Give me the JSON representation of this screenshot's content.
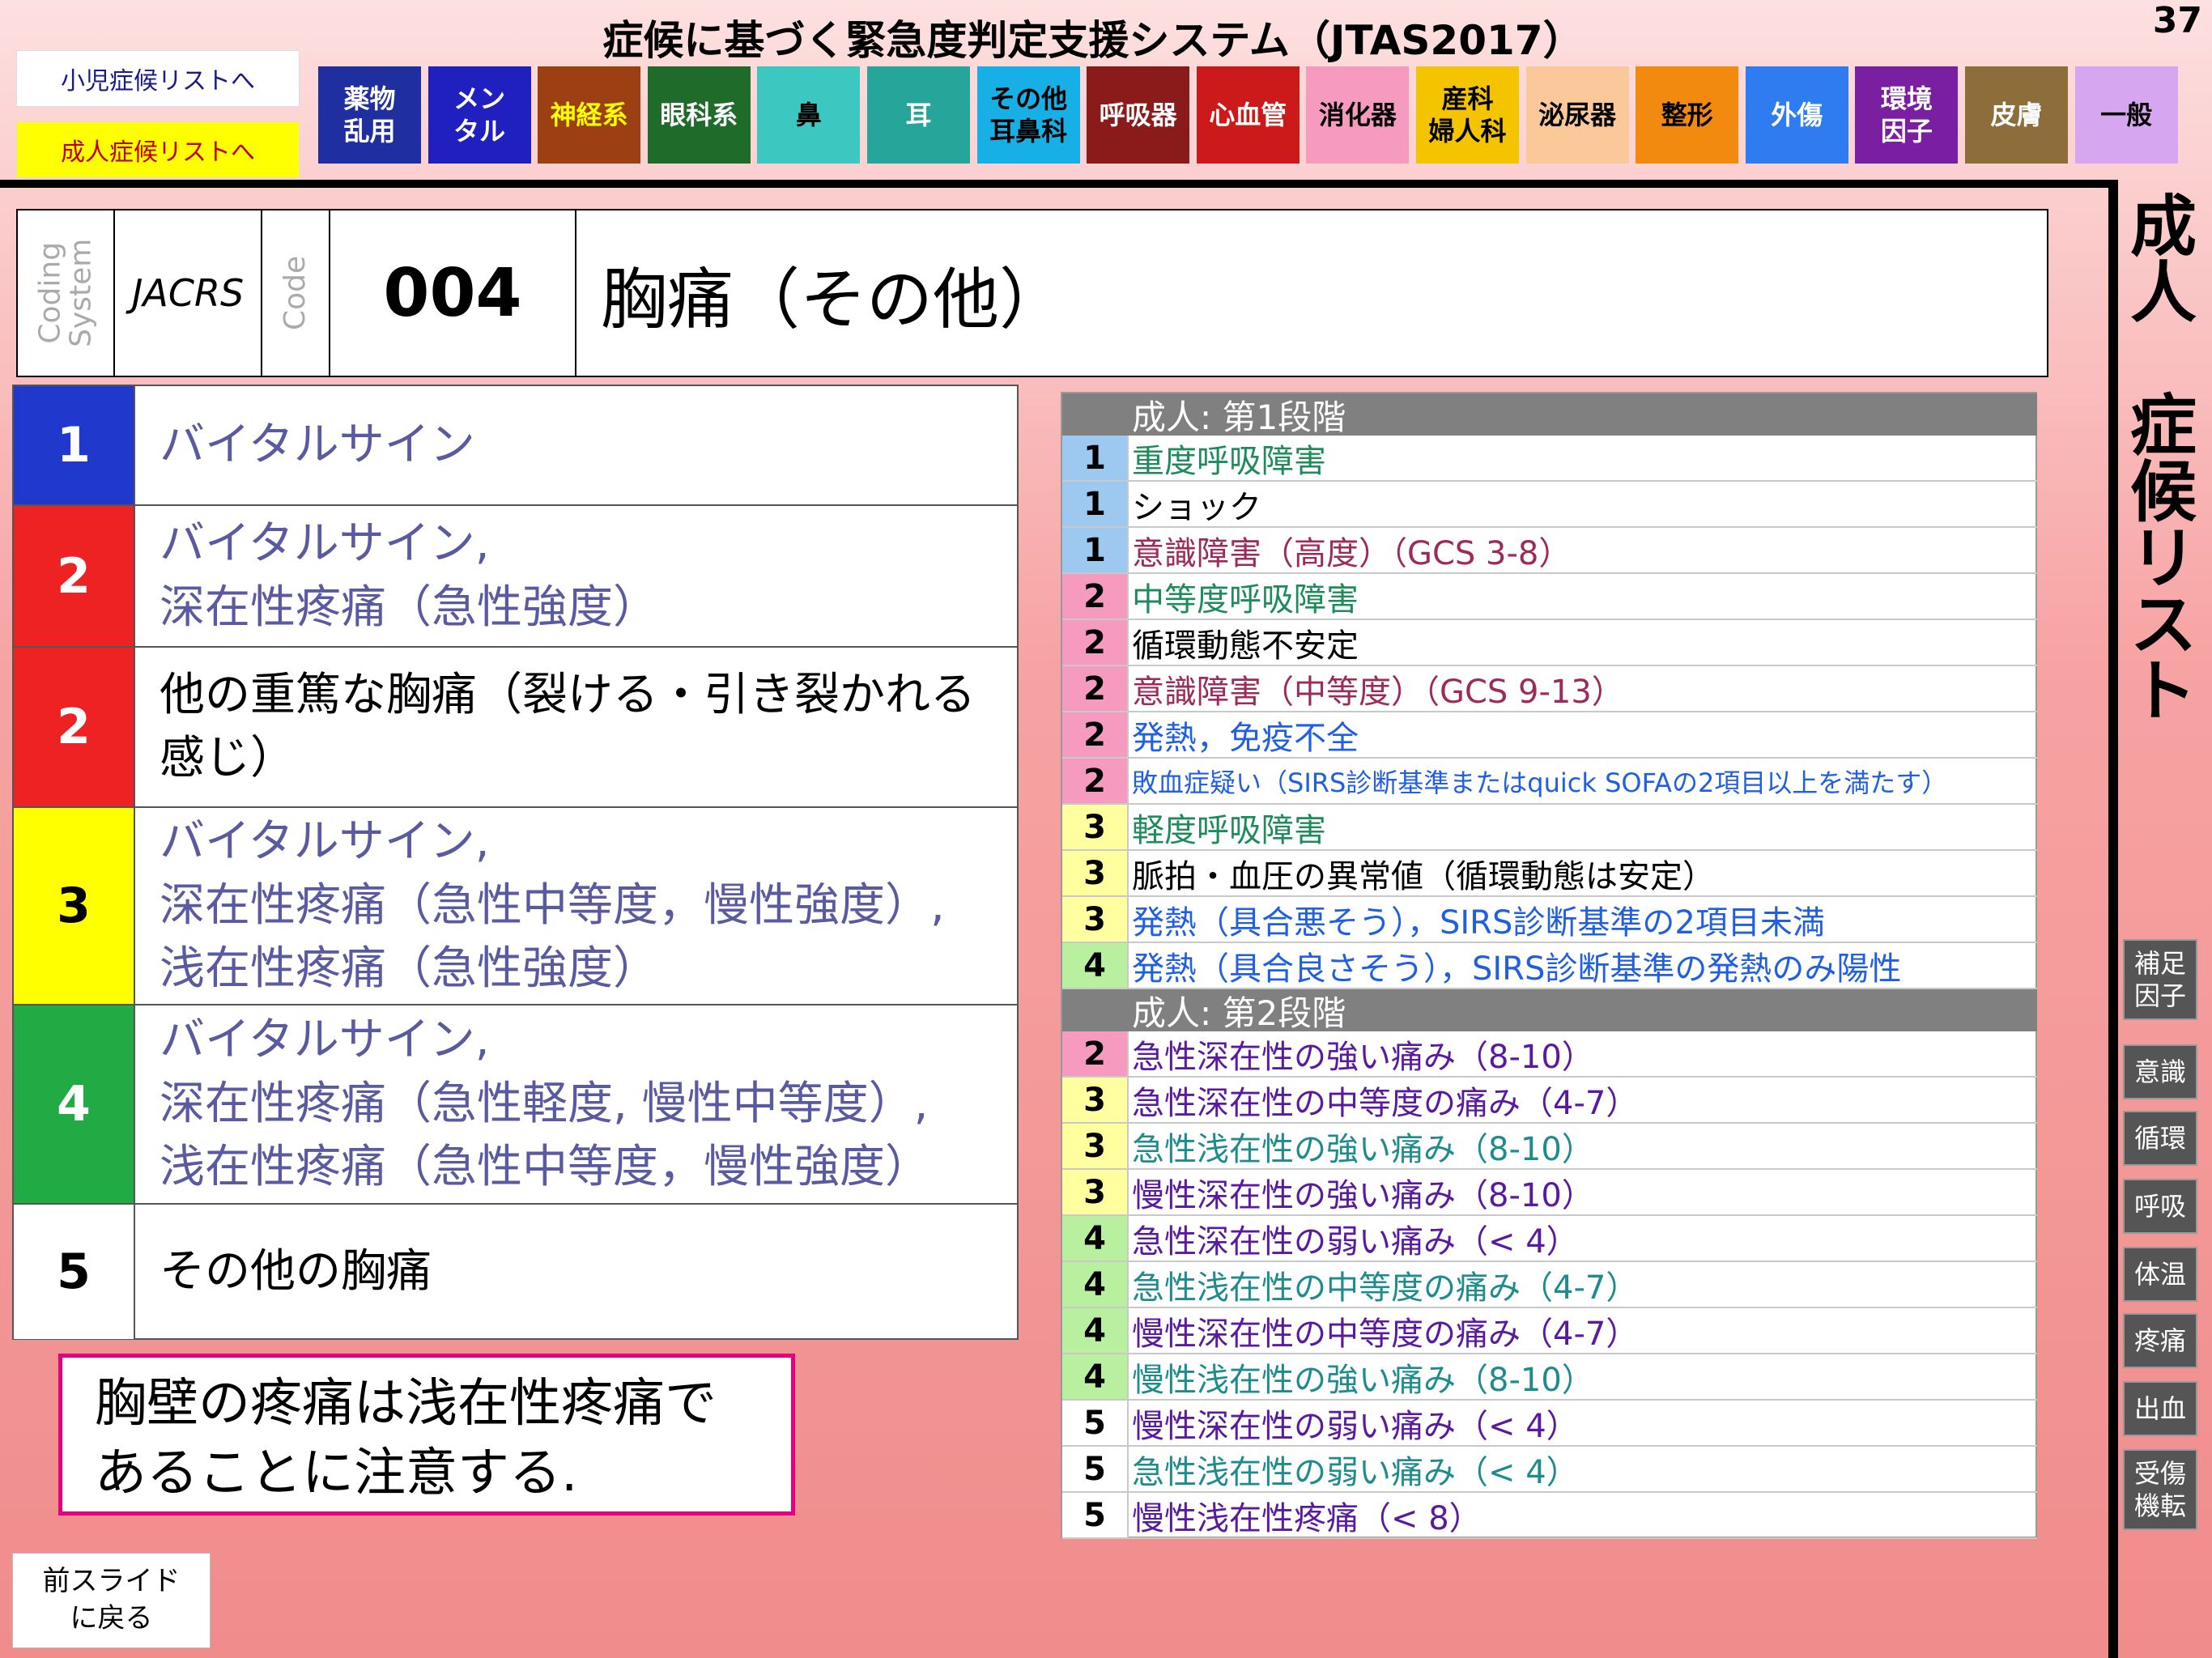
{
  "header": {
    "title": "症候に基づく緊急度判定支援システム（JTAS2017）",
    "page_number": "37"
  },
  "nav": {
    "child_list": "小児症候リストへ",
    "adult_list": "成人症候リストへ"
  },
  "categories": [
    {
      "line1": "薬物",
      "line2": "乱用",
      "bg": "#1f2fa0",
      "fg": "#ffffff"
    },
    {
      "line1": "メン",
      "line2": "タル",
      "bg": "#2020c0",
      "fg": "#ffffff"
    },
    {
      "line1": "神経系",
      "line2": "",
      "bg": "#9c4014",
      "fg": "#ffff00"
    },
    {
      "line1": "眼科系",
      "line2": "",
      "bg": "#1f6b2a",
      "fg": "#ffffff"
    },
    {
      "line1": "鼻",
      "line2": "",
      "bg": "#3cc8c0",
      "fg": "#000000"
    },
    {
      "line1": "耳",
      "line2": "",
      "bg": "#26a69a",
      "fg": "#ffffff"
    },
    {
      "line1": "その他",
      "line2": "耳鼻科",
      "bg": "#17b0e6",
      "fg": "#000000"
    },
    {
      "line1": "呼吸器",
      "line2": "",
      "bg": "#8b1a1a",
      "fg": "#ffffff"
    },
    {
      "line1": "心血管",
      "line2": "",
      "bg": "#cc1a1a",
      "fg": "#ffffff"
    },
    {
      "line1": "消化器",
      "line2": "",
      "bg": "#f79ac0",
      "fg": "#000000"
    },
    {
      "line1": "産科",
      "line2": "婦人科",
      "bg": "#f5c400",
      "fg": "#000000"
    },
    {
      "line1": "泌尿器",
      "line2": "",
      "bg": "#fbc89a",
      "fg": "#000000"
    },
    {
      "line1": "整形",
      "line2": "",
      "bg": "#f28a10",
      "fg": "#000000"
    },
    {
      "line1": "外傷",
      "line2": "",
      "bg": "#2e7cf0",
      "fg": "#ffffff"
    },
    {
      "line1": "環境",
      "line2": "因子",
      "bg": "#7b1fa2",
      "fg": "#ffffff"
    },
    {
      "line1": "皮膚",
      "line2": "",
      "bg": "#8d6e3a",
      "fg": "#ffffff"
    },
    {
      "line1": "一般",
      "line2": "",
      "bg": "#d7a6f0",
      "fg": "#000000"
    }
  ],
  "code_header": {
    "coding_label_1": "Coding",
    "coding_label_2": "System",
    "system": "JACRS",
    "code_label": "Code",
    "code": "004",
    "symptom": "胸痛（その他）"
  },
  "levels": [
    {
      "num": "1",
      "bg": "#2038cc",
      "fg": "#ffffff",
      "color": "#5a5aa0",
      "lines": [
        "バイタルサイン"
      ]
    },
    {
      "num": "2",
      "bg": "#ee2222",
      "fg": "#ffffff",
      "color": "#5a5aa0",
      "lines": [
        "バイタルサイン,",
        "深在性疼痛（急性強度）"
      ]
    },
    {
      "num": "2",
      "bg": "#ee2222",
      "fg": "#ffffff",
      "color": "#000000",
      "lines": [
        "他の重篤な胸痛（裂ける・引き裂かれる",
        "感じ）"
      ]
    },
    {
      "num": "3",
      "bg": "#ffff00",
      "fg": "#000000",
      "color": "#5a5aa0",
      "lines": [
        "バイタルサイン,",
        "深在性疼痛（急性中等度，慢性強度）,",
        "浅在性疼痛（急性強度）"
      ]
    },
    {
      "num": "4",
      "bg": "#22aa44",
      "fg": "#ffffff",
      "color": "#5a5aa0",
      "lines": [
        "バイタルサイン,",
        "深在性疼痛（急性軽度, 慢性中等度）,",
        "浅在性疼痛（急性中等度，慢性強度）"
      ]
    },
    {
      "num": "5",
      "bg": "#ffffff",
      "fg": "#000000",
      "color": "#000000",
      "lines": [
        "その他の胸痛"
      ]
    }
  ],
  "note": {
    "line1": "胸壁の疼痛は浅在性疼痛で",
    "line2": "あることに注意する."
  },
  "back_button": {
    "line1": "前スライド",
    "line2": "に戻る"
  },
  "stage1": {
    "title": "成人: 第1段階",
    "rows": [
      {
        "level": "1",
        "text": "重度呼吸障害",
        "color": "#1e8c5a"
      },
      {
        "level": "1",
        "text": "ショック",
        "color": "#000000"
      },
      {
        "level": "1",
        "text": "意識障害（高度）（GCS 3-8）",
        "color": "#9c2a5a"
      },
      {
        "level": "2",
        "text": "中等度呼吸障害",
        "color": "#1e8c5a"
      },
      {
        "level": "2",
        "text": "循環動態不安定",
        "color": "#000000"
      },
      {
        "level": "2",
        "text": "意識障害（中等度）（GCS 9-13）",
        "color": "#9c2a5a"
      },
      {
        "level": "2",
        "text": "発熱，免疫不全",
        "color": "#2060e0"
      },
      {
        "level": "2",
        "text": "敗血症疑い（SIRS診断基準またはquick SOFAの2項目以上を満たす）",
        "color": "#2060e0"
      },
      {
        "level": "3",
        "text": "軽度呼吸障害",
        "color": "#1e8c5a"
      },
      {
        "level": "3",
        "text": "脈拍・血圧の異常値（循環動態は安定）",
        "color": "#000000"
      },
      {
        "level": "3",
        "text": "発熱（具合悪そう），SIRS診断基準の2項目未満",
        "color": "#2060e0"
      },
      {
        "level": "4",
        "text": "発熱（具合良さそう），SIRS診断基準の発熱のみ陽性",
        "color": "#2060e0"
      }
    ]
  },
  "stage2": {
    "title": "成人: 第2段階",
    "rows": [
      {
        "level": "2",
        "text": "急性深在性の強い痛み（8-10）",
        "color": "#5a1aa0"
      },
      {
        "level": "3",
        "text": "急性深在性の中等度の痛み（4-7）",
        "color": "#5a1aa0"
      },
      {
        "level": "3",
        "text": "急性浅在性の強い痛み（8-10）",
        "color": "#1e8c8c"
      },
      {
        "level": "3",
        "text": "慢性深在性の強い痛み（8-10）",
        "color": "#5a1aa0"
      },
      {
        "level": "4",
        "text": "急性深在性の弱い痛み（< 4）",
        "color": "#5a1aa0"
      },
      {
        "level": "4",
        "text": "急性浅在性の中等度の痛み（4-7）",
        "color": "#1e8c8c"
      },
      {
        "level": "4",
        "text": "慢性深在性の中等度の痛み（4-7）",
        "color": "#5a1aa0"
      },
      {
        "level": "4",
        "text": "慢性浅在性の強い痛み（8-10）",
        "color": "#1e8c8c"
      },
      {
        "level": "5",
        "text": "慢性深在性の弱い痛み（< 4）",
        "color": "#5a1aa0"
      },
      {
        "level": "5",
        "text": "急性浅在性の弱い痛み（< 4）",
        "color": "#1e8c8c"
      },
      {
        "level": "5",
        "text": "慢性浅在性疼痛（< 8）",
        "color": "#5a1aa0"
      }
    ]
  },
  "level_colors": {
    "1": "#9dc8f0",
    "2": "#f79ac0",
    "3": "#ffffa0",
    "4": "#b8f0a0",
    "5": "#ffffff"
  },
  "side": {
    "title_chars": [
      "成",
      "人",
      "",
      "症",
      "候",
      "リ",
      "ス",
      "ト"
    ],
    "buttons": [
      {
        "line1": "補足",
        "line2": "因子"
      },
      {
        "line1": "意識",
        "line2": ""
      },
      {
        "line1": "循環",
        "line2": ""
      },
      {
        "line1": "呼吸",
        "line2": ""
      },
      {
        "line1": "体温",
        "line2": ""
      },
      {
        "line1": "疼痛",
        "line2": ""
      },
      {
        "line1": "出血",
        "line2": ""
      },
      {
        "line1": "受傷",
        "line2": "機転"
      }
    ]
  }
}
